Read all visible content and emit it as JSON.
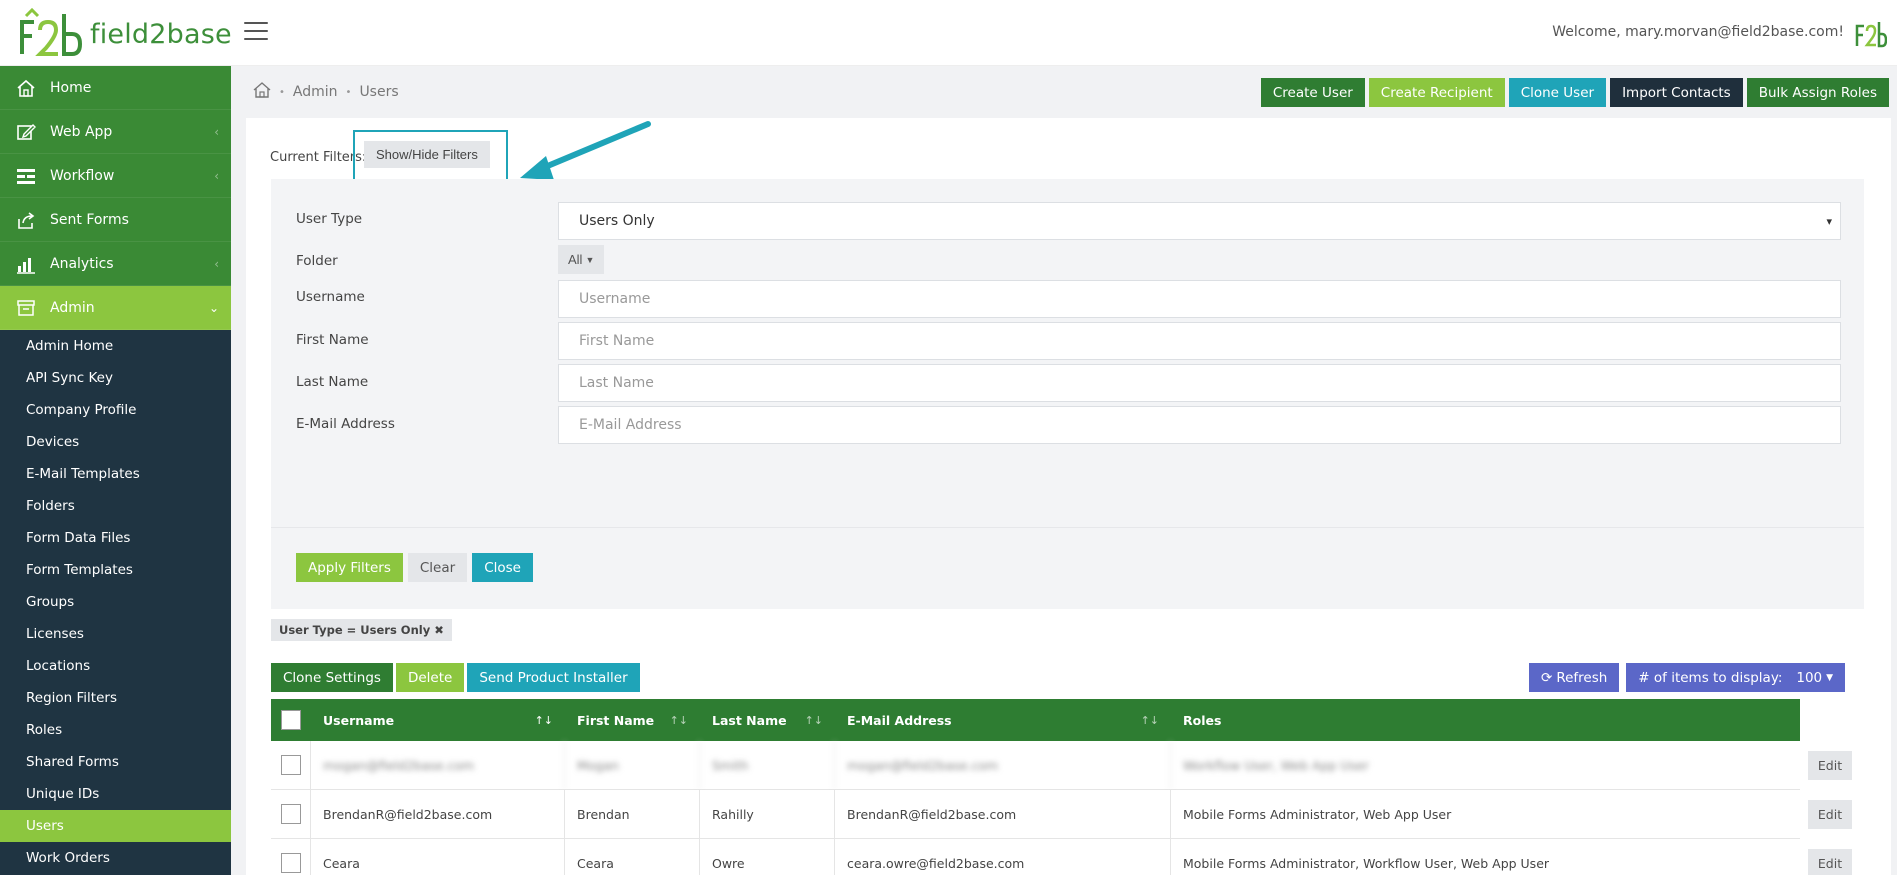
{
  "header": {
    "logo_text": "field2base",
    "welcome": "Welcome, mary.morvan@field2base.com!"
  },
  "sidebar": {
    "main_items": [
      {
        "label": "Home",
        "icon": "home-icon",
        "has_chevron": false
      },
      {
        "label": "Web App",
        "icon": "edit-icon",
        "has_chevron": true
      },
      {
        "label": "Workflow",
        "icon": "workflow-icon",
        "has_chevron": true
      },
      {
        "label": "Sent Forms",
        "icon": "share-icon",
        "has_chevron": false
      },
      {
        "label": "Analytics",
        "icon": "bar-chart-icon",
        "has_chevron": true
      },
      {
        "label": "Admin",
        "icon": "archive-icon",
        "has_chevron": true,
        "active": true
      }
    ],
    "admin_items": [
      "Admin Home",
      "API Sync Key",
      "Company Profile",
      "Devices",
      "E-Mail Templates",
      "Folders",
      "Form Data Files",
      "Form Templates",
      "Groups",
      "Licenses",
      "Locations",
      "Region Filters",
      "Roles",
      "Shared Forms",
      "Unique IDs",
      "Users",
      "Work Orders"
    ],
    "active_admin_item": "Users"
  },
  "breadcrumb": {
    "items": [
      "Admin",
      "Users"
    ]
  },
  "actions": {
    "create_user": "Create User",
    "create_recipient": "Create Recipient",
    "clone_user": "Clone User",
    "import_contacts": "Import Contacts",
    "bulk_assign_roles": "Bulk Assign Roles"
  },
  "filters": {
    "current_label": "Current Filters:",
    "show_hide": "Show/Hide Filters",
    "user_type_label": "User Type",
    "user_type_value": "Users Only",
    "folder_label": "Folder",
    "folder_value": "All",
    "username_label": "Username",
    "username_placeholder": "Username",
    "first_name_label": "First Name",
    "first_name_placeholder": "First Name",
    "last_name_label": "Last Name",
    "last_name_placeholder": "Last Name",
    "email_label": "E-Mail Address",
    "email_placeholder": "E-Mail Address",
    "apply": "Apply Filters",
    "clear": "Clear",
    "close": "Close",
    "active_tag": "User Type = Users Only"
  },
  "table_actions": {
    "clone_settings": "Clone Settings",
    "delete": "Delete",
    "send_installer": "Send Product Installer",
    "refresh": "Refresh",
    "items_label": "# of items to display:",
    "items_value": "100"
  },
  "table": {
    "columns": [
      "Username",
      "First Name",
      "Last Name",
      "E-Mail Address",
      "Roles"
    ],
    "rows": [
      {
        "username": "mogan@field2base.com",
        "first": "Mogan",
        "last": "Smith",
        "email": "mogan@field2base.com",
        "roles": "Workflow User, Web App User",
        "blurred": true
      },
      {
        "username": "BrendanR@field2base.com",
        "first": "Brendan",
        "last": "Rahilly",
        "email": "BrendanR@field2base.com",
        "roles": "Mobile Forms Administrator, Web App User",
        "blurred": false
      },
      {
        "username": "Ceara",
        "first": "Ceara",
        "last": "Owre",
        "email": "ceara.owre@field2base.com",
        "roles": "Mobile Forms Administrator, Workflow User, Web App User",
        "blurred": false
      }
    ],
    "edit_label": "Edit"
  },
  "colors": {
    "sidebar_green": "#3a8a35",
    "active_lime": "#8cc63f",
    "sidebar_navy": "#1f3442",
    "teal": "#1fa4b8",
    "table_header": "#2e7d32"
  }
}
